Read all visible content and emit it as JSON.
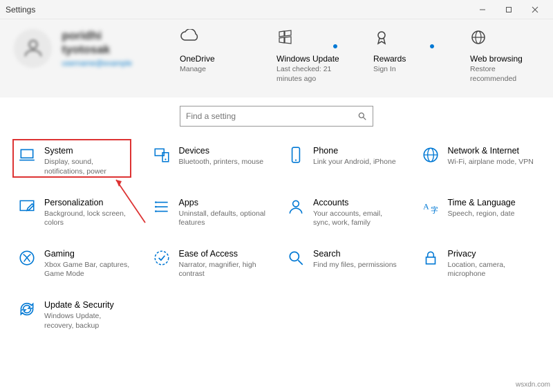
{
  "window": {
    "title": "Settings"
  },
  "user": {
    "name": "poridhi tyotosak",
    "link": "username@example"
  },
  "tiles": [
    {
      "icon": "cloud",
      "title": "OneDrive",
      "sub": "Manage",
      "dot": false
    },
    {
      "icon": "update",
      "title": "Windows Update",
      "sub": "Last checked: 21 minutes ago",
      "dot": true
    },
    {
      "icon": "rewards",
      "title": "Rewards",
      "sub": "Sign In",
      "dot": true
    },
    {
      "icon": "globe",
      "title": "Web browsing",
      "sub": "Restore recommended",
      "dot": false
    }
  ],
  "search": {
    "placeholder": "Find a setting"
  },
  "categories": [
    {
      "id": "system",
      "icon": "laptop",
      "title": "System",
      "sub": "Display, sound, notifications, power"
    },
    {
      "id": "devices",
      "icon": "devices",
      "title": "Devices",
      "sub": "Bluetooth, printers, mouse"
    },
    {
      "id": "phone",
      "icon": "phone",
      "title": "Phone",
      "sub": "Link your Android, iPhone"
    },
    {
      "id": "network",
      "icon": "globe-net",
      "title": "Network & Internet",
      "sub": "Wi-Fi, airplane mode, VPN"
    },
    {
      "id": "personalization",
      "icon": "pencil",
      "title": "Personalization",
      "sub": "Background, lock screen, colors"
    },
    {
      "id": "apps",
      "icon": "apps",
      "title": "Apps",
      "sub": "Uninstall, defaults, optional features"
    },
    {
      "id": "accounts",
      "icon": "person",
      "title": "Accounts",
      "sub": "Your accounts, email, sync, work, family"
    },
    {
      "id": "time",
      "icon": "language",
      "title": "Time & Language",
      "sub": "Speech, region, date"
    },
    {
      "id": "gaming",
      "icon": "xbox",
      "title": "Gaming",
      "sub": "Xbox Game Bar, captures, Game Mode"
    },
    {
      "id": "ease",
      "icon": "ease",
      "title": "Ease of Access",
      "sub": "Narrator, magnifier, high contrast"
    },
    {
      "id": "search",
      "icon": "search",
      "title": "Search",
      "sub": "Find my files, permissions"
    },
    {
      "id": "privacy",
      "icon": "lock",
      "title": "Privacy",
      "sub": "Location, camera, microphone"
    },
    {
      "id": "update",
      "icon": "sync",
      "title": "Update & Security",
      "sub": "Windows Update, recovery, backup"
    }
  ],
  "watermark": "wsxdn.com"
}
